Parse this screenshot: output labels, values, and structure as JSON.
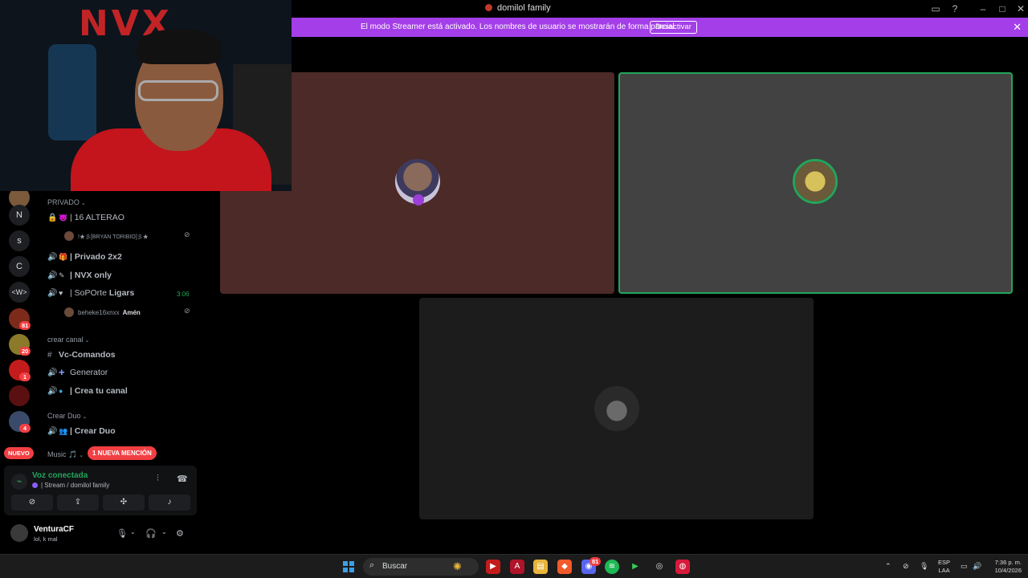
{
  "window": {
    "title": "domilol family"
  },
  "banner": {
    "text": "El modo Streamer está activado. Los nombres de usuario se mostrarán de forma parcial.",
    "button": "Desactivar"
  },
  "webcam": {
    "neon_text": "NVX"
  },
  "rail": {
    "letters": [
      "N",
      "s",
      "C",
      "<W>"
    ],
    "badges": [
      "81",
      "20",
      "1",
      "4"
    ],
    "nuevo": "NUEVO"
  },
  "sidebar": {
    "cat_privado": "PRIVADO",
    "ch_alterao": "| 16 ALTERAO",
    "user_bryan": "!★彡[BRYAN TORIBIO]彡★",
    "ch_privado2x2": "| Privado 2x2",
    "ch_nvx": "| NVX only",
    "ch_soporte_a": "| SoPOrte ",
    "ch_soporte_b": "Ligars",
    "ch_soporte_time": "3:06",
    "user_beheke": "beheke16xnxx",
    "user_beheke_tag": "Amén",
    "cat_crear_canal": "crear canal",
    "ch_vc": "Vc-Comandos",
    "ch_generator": "Generator",
    "ch_crea": "| Crea tu canal",
    "cat_crear_duo": "Crear Duo",
    "ch_crear_duo": "| Crear Duo",
    "cat_music": "Music 🎵",
    "mention": "1 NUEVA MENCIÓN"
  },
  "voice": {
    "status": "Voz conectada",
    "sub": "| Stream / domilol family"
  },
  "user": {
    "name": "VenturaCF",
    "status": "lol, k mal"
  },
  "taskbar": {
    "search": "Buscar",
    "discord_badge": "81",
    "lang1": "ESP",
    "lang2": "LAA",
    "time": "7:36 p. m.",
    "date": "10/4/2026"
  }
}
